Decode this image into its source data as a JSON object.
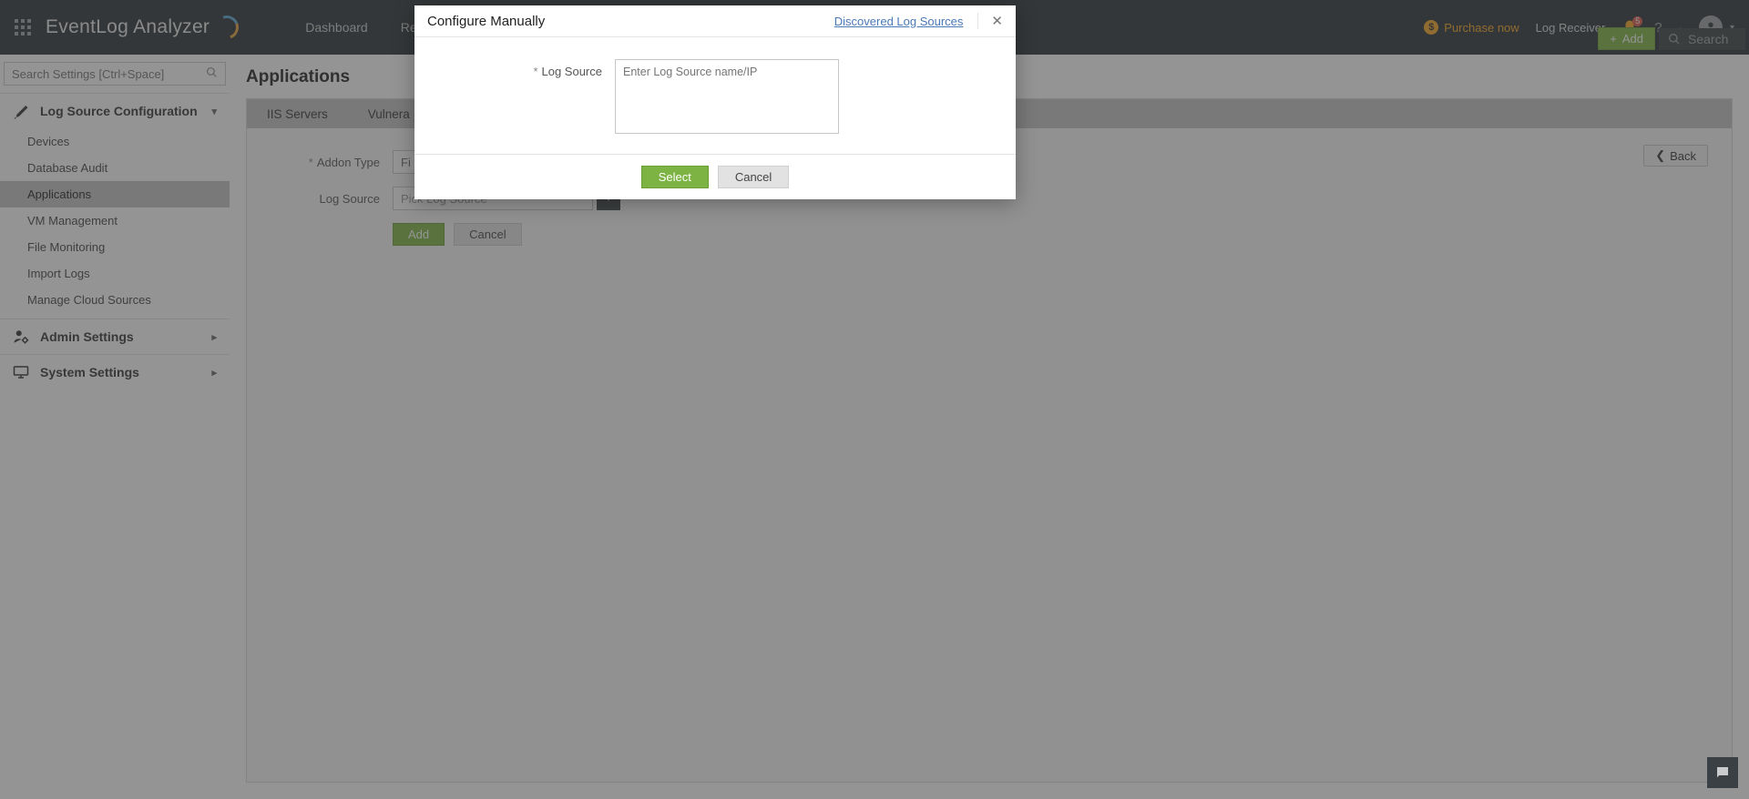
{
  "header": {
    "product": "EventLog Analyzer",
    "nav": [
      "Dashboard",
      "Reports"
    ],
    "purchase": "Purchase now",
    "log_receiver": "Log Receiver",
    "notif_count": "5",
    "add_label": "Add",
    "search_placeholder": "Search"
  },
  "sidebar": {
    "search_placeholder": "Search Settings [Ctrl+Space]",
    "sections": {
      "config": {
        "title": "Log Source Configuration",
        "items": [
          "Devices",
          "Database Audit",
          "Applications",
          "VM Management",
          "File Monitoring",
          "Import Logs",
          "Manage Cloud Sources"
        ],
        "active_index": 2
      },
      "admin": {
        "title": "Admin Settings"
      },
      "system": {
        "title": "System Settings"
      }
    }
  },
  "main": {
    "title": "Applications",
    "tabs": [
      "IIS Servers",
      "Vulnera"
    ],
    "back": "Back",
    "form": {
      "addon_type_label": "Addon Type",
      "addon_type_value": "Fi",
      "log_source_label": "Log Source",
      "log_source_placeholder": "Pick Log Source",
      "add": "Add",
      "cancel": "Cancel"
    }
  },
  "modal": {
    "title": "Configure Manually",
    "discovered": "Discovered Log Sources",
    "label": "Log Source",
    "placeholder": "Enter Log Source name/IP",
    "select": "Select",
    "cancel": "Cancel"
  }
}
